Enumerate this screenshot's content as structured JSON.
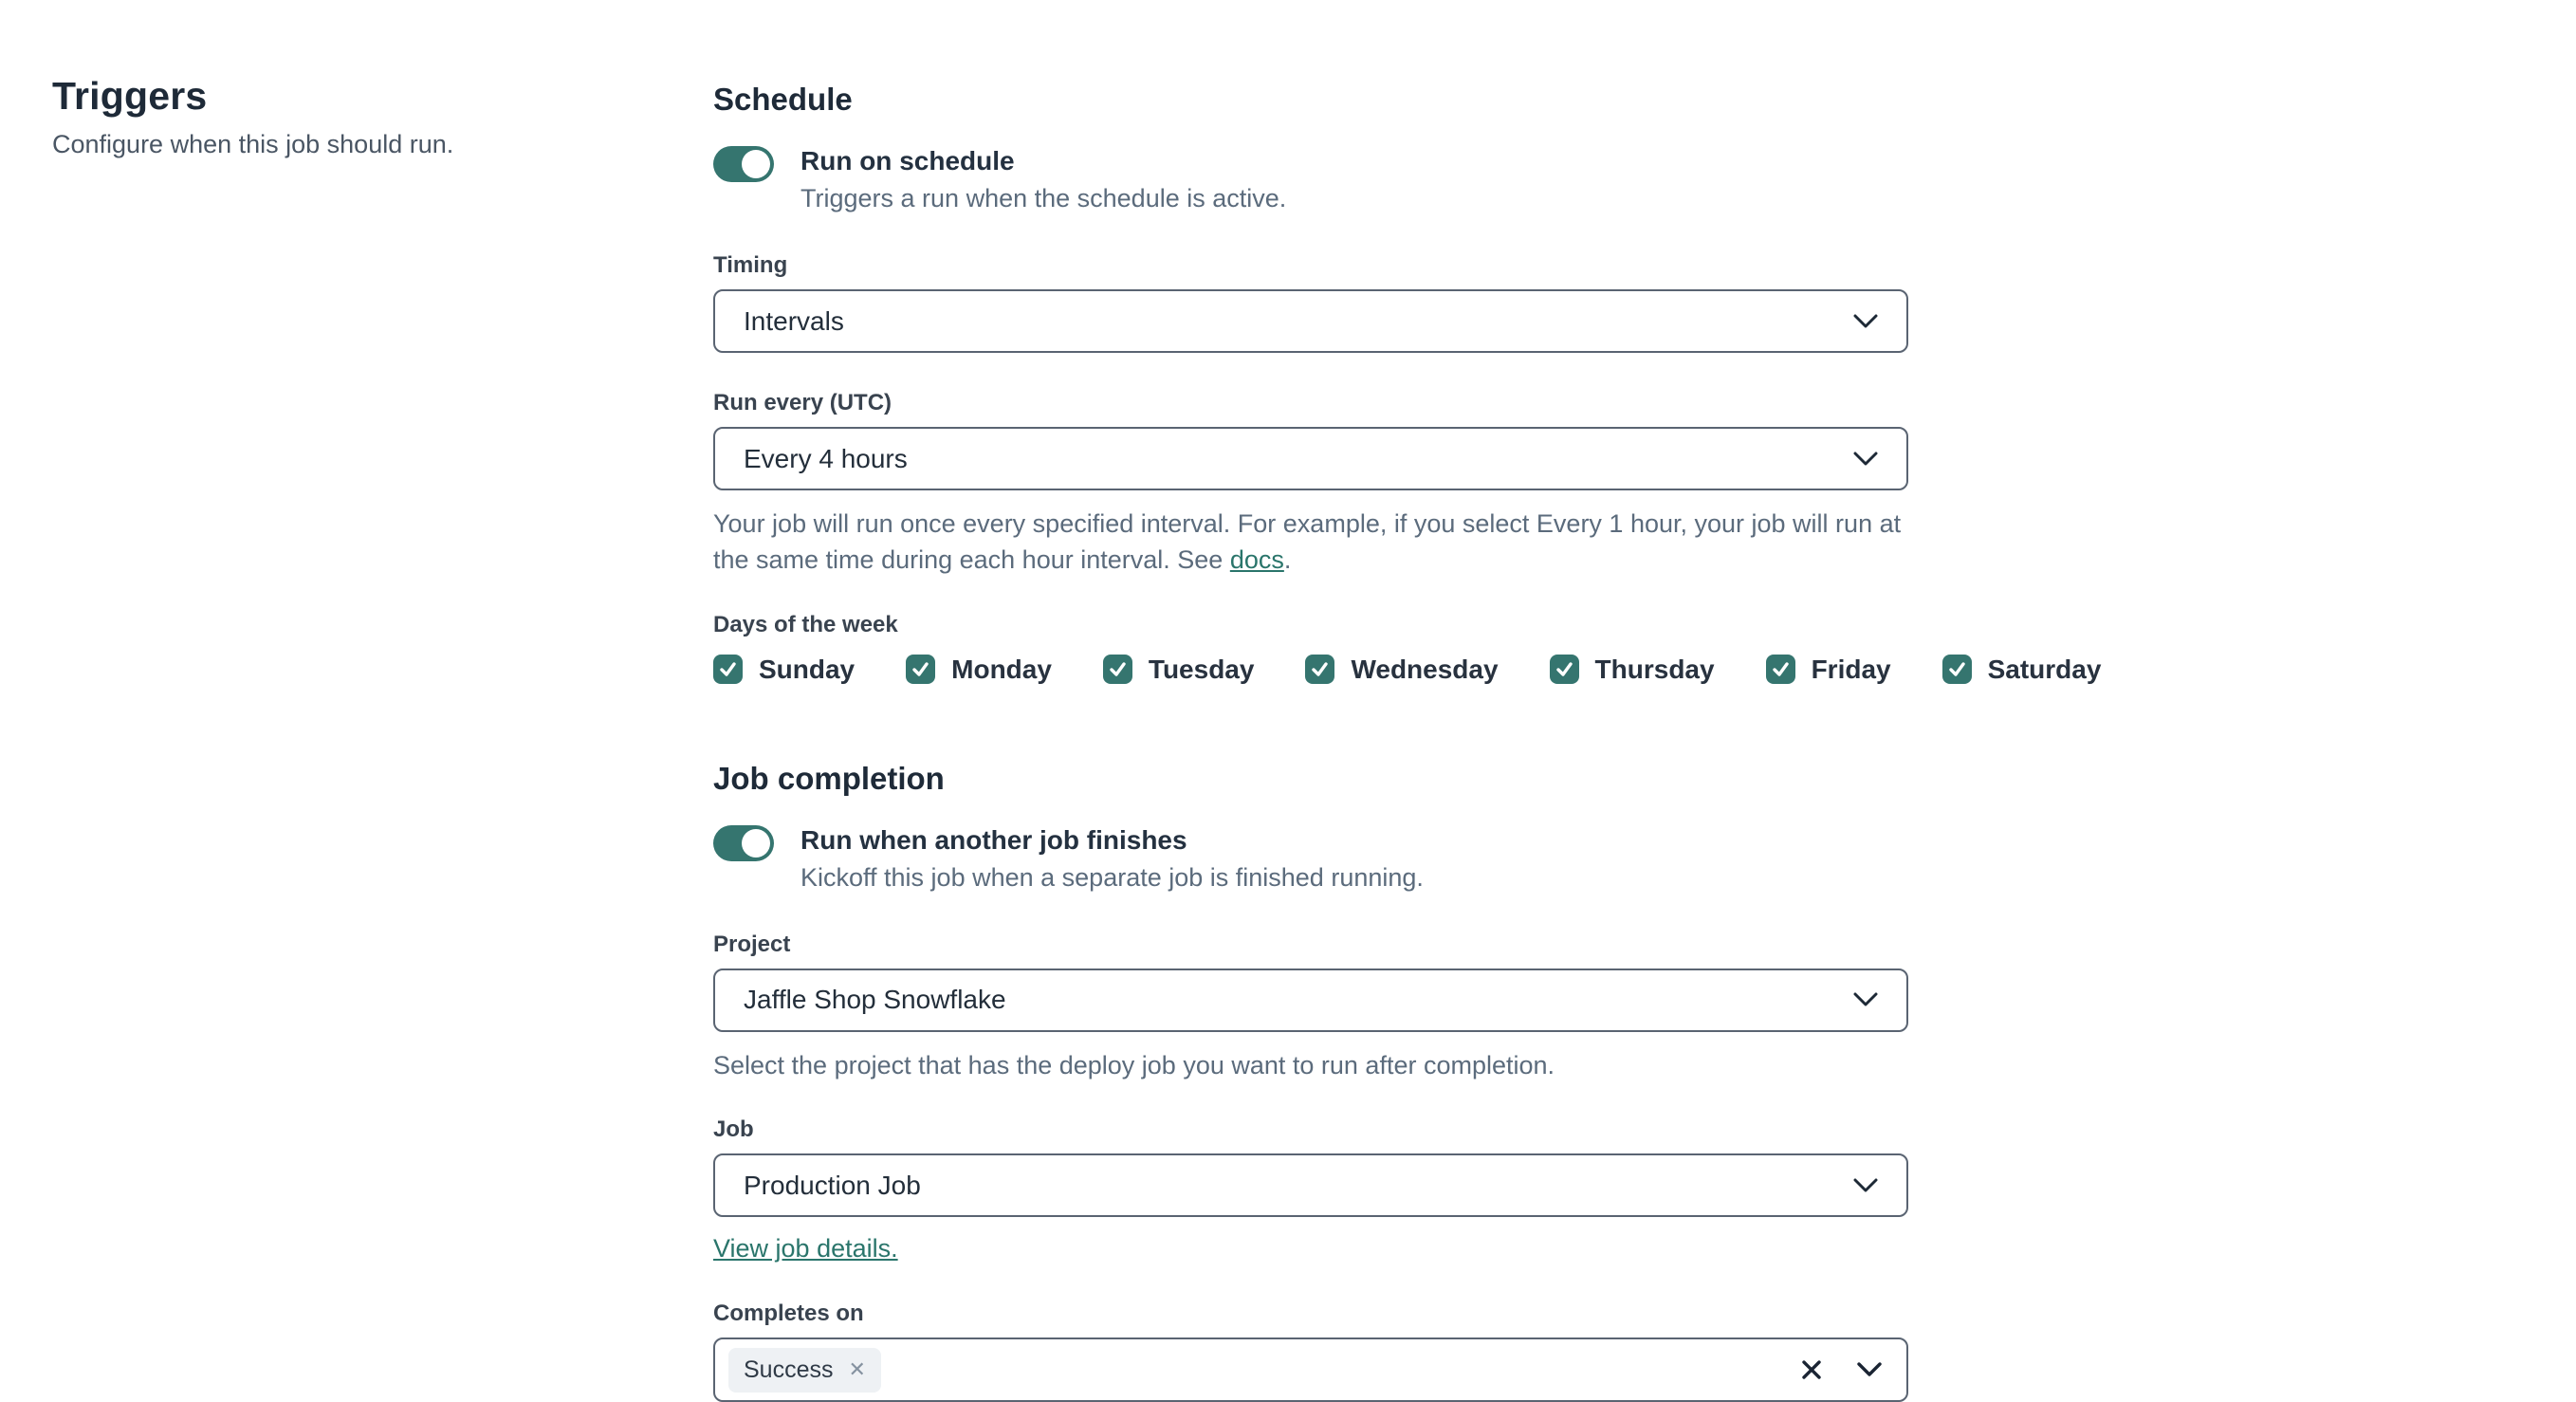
{
  "colors": {
    "accent_teal": "#35756f",
    "link_teal": "#2a756b",
    "heading_text": "#1e2a38",
    "body_text": "#243140",
    "muted_text": "#5b6b7c",
    "field_border": "#5a6472",
    "tag_background": "#eef1f4"
  },
  "left_panel": {
    "title": "Triggers",
    "subtitle": "Configure when this job should run."
  },
  "schedule": {
    "heading": "Schedule",
    "toggle": {
      "state": "on",
      "label": "Run on schedule",
      "description": "Triggers a run when the schedule is active."
    },
    "timing": {
      "label": "Timing",
      "value": "Intervals"
    },
    "run_every": {
      "label": "Run every (UTC)",
      "value": "Every 4 hours",
      "help_before_link": "Your job will run once every specified interval. For example, if you select Every 1 hour, your job will run at the same time during each hour interval. See ",
      "help_link": "docs",
      "help_after_link": "."
    },
    "days": {
      "label": "Days of the week",
      "items": [
        {
          "label": "Sunday",
          "checked": true
        },
        {
          "label": "Monday",
          "checked": true
        },
        {
          "label": "Tuesday",
          "checked": true
        },
        {
          "label": "Wednesday",
          "checked": true
        },
        {
          "label": "Thursday",
          "checked": true
        },
        {
          "label": "Friday",
          "checked": true
        },
        {
          "label": "Saturday",
          "checked": true
        }
      ]
    }
  },
  "job_completion": {
    "heading": "Job completion",
    "toggle": {
      "state": "on",
      "label": "Run when another job finishes",
      "description": "Kickoff this job when a separate job is finished running."
    },
    "project": {
      "label": "Project",
      "value": "Jaffle Shop Snowflake",
      "help": "Select the project that has the deploy job you want to run after completion."
    },
    "job": {
      "label": "Job",
      "value": "Production Job",
      "link": "View job details."
    },
    "completes_on": {
      "label": "Completes on",
      "tags": [
        {
          "label": "Success"
        }
      ]
    }
  }
}
